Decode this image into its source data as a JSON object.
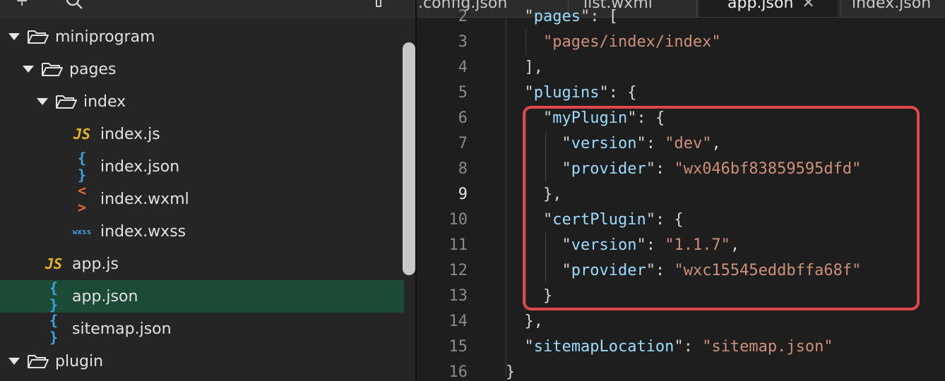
{
  "colors": {
    "selected_row": "#1b4b37",
    "highlight_border": "#e0474c",
    "json_key": "#9cdcfe",
    "json_string": "#ce9178",
    "js_icon": "#e6b422",
    "json_icon": "#3fa3e0",
    "wxml_icon": "#e8692d"
  },
  "sidebar": {
    "toolbar_icons": [
      "add-icon",
      "search-icon",
      "collapse-icon",
      "more-icon"
    ],
    "tree": [
      {
        "label": "miniprogram",
        "type": "folder",
        "expanded": true,
        "depth": 0
      },
      {
        "label": "pages",
        "type": "folder",
        "expanded": true,
        "depth": 1
      },
      {
        "label": "index",
        "type": "folder",
        "expanded": true,
        "depth": 2
      },
      {
        "label": "index.js",
        "type": "js",
        "icon_text": "JS",
        "depth": 3
      },
      {
        "label": "index.json",
        "type": "json",
        "icon_text": "{ }",
        "depth": 3
      },
      {
        "label": "index.wxml",
        "type": "wxml",
        "icon_text": "< >",
        "depth": 3
      },
      {
        "label": "index.wxss",
        "type": "wxss",
        "icon_text": "wxss",
        "depth": 3
      },
      {
        "label": "app.js",
        "type": "js",
        "icon_text": "JS",
        "depth": 1
      },
      {
        "label": "app.json",
        "type": "json",
        "icon_text": "{ }",
        "depth": 1,
        "selected": true
      },
      {
        "label": "sitemap.json",
        "type": "json",
        "icon_text": "{ }",
        "depth": 1
      },
      {
        "label": "plugin",
        "type": "folder",
        "expanded": true,
        "depth": 0
      }
    ]
  },
  "editor": {
    "tabs": [
      {
        "label": ".config.json",
        "active": false
      },
      {
        "label": "list.wxml",
        "active": false
      },
      {
        "label": "app.json",
        "active": true,
        "close": "✕"
      },
      {
        "label": "index.json",
        "active": false
      }
    ],
    "current_line": 9,
    "lines": [
      {
        "n": "2",
        "text": "  \"pages\": ["
      },
      {
        "n": "3",
        "text": "    \"pages/index/index\""
      },
      {
        "n": "4",
        "text": "  ],"
      },
      {
        "n": "5",
        "text": "  \"plugins\": {"
      },
      {
        "n": "6",
        "text": "    \"myPlugin\": {"
      },
      {
        "n": "7",
        "text": "      \"version\": \"dev\","
      },
      {
        "n": "8",
        "text": "      \"provider\": \"wx046bf83859595dfd\""
      },
      {
        "n": "9",
        "text": "    },"
      },
      {
        "n": "10",
        "text": "    \"certPlugin\": {"
      },
      {
        "n": "11",
        "text": "      \"version\": \"1.1.7\","
      },
      {
        "n": "12",
        "text": "      \"provider\": \"wxc15545eddbffa68f\""
      },
      {
        "n": "13",
        "text": "    }"
      },
      {
        "n": "14",
        "text": "  },"
      },
      {
        "n": "15",
        "text": "  \"sitemapLocation\": \"sitemap.json\""
      },
      {
        "n": "16",
        "text": "}"
      }
    ]
  }
}
